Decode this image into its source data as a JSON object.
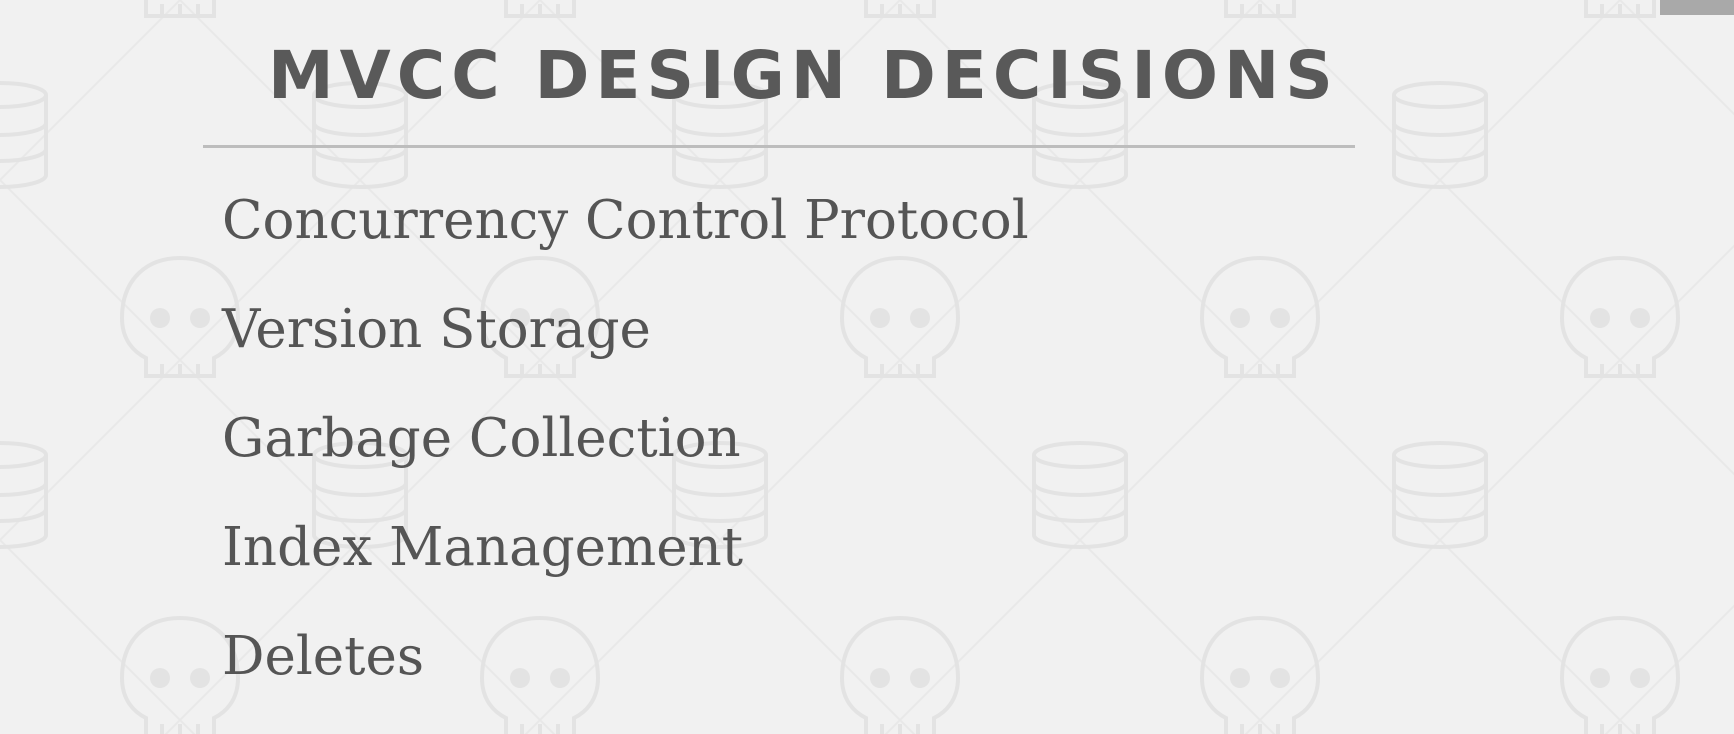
{
  "slide": {
    "title": "MVCC DESIGN DECISIONS",
    "items": [
      "Concurrency Control Protocol",
      "Version Storage",
      "Garbage Collection",
      "Index Management",
      "Deletes"
    ]
  },
  "background": {
    "icons": [
      "database-icon",
      "skull-icon"
    ],
    "color": "#f1f1f1"
  },
  "colors": {
    "text": "#555555",
    "rule": "#bdbdbd",
    "corner_tab": "#a9a9a9"
  }
}
